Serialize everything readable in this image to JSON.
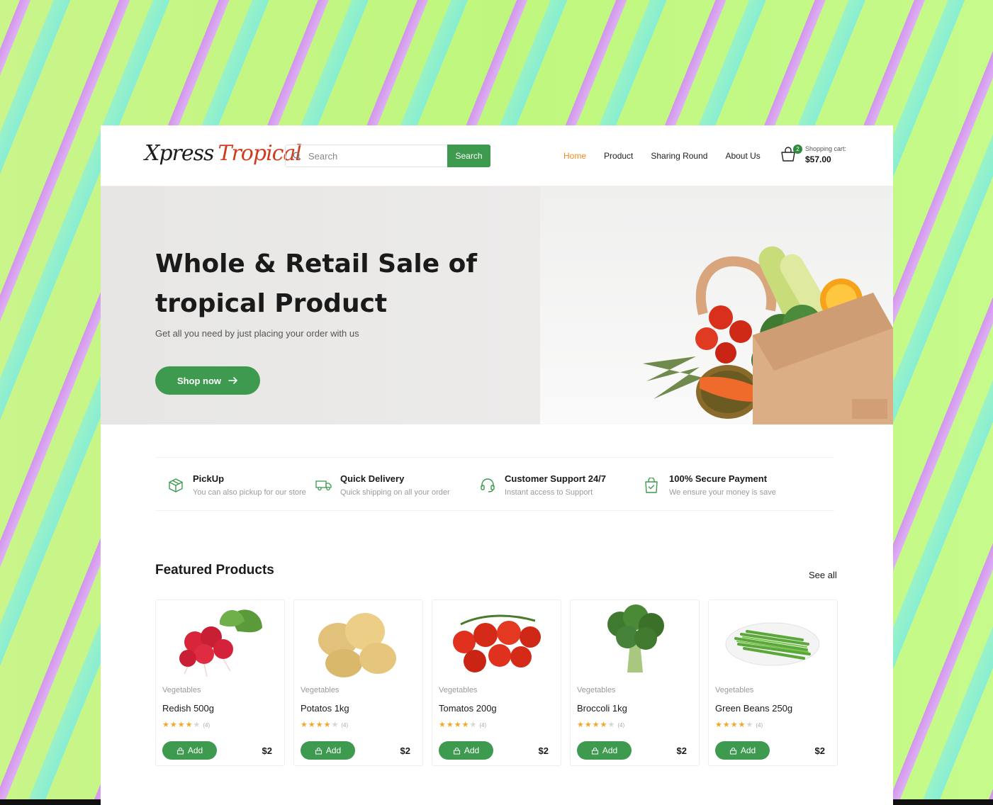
{
  "header": {
    "logo_part1": "Xpress",
    "logo_part2": "Tropical",
    "search_placeholder": "Search",
    "search_button": "Search",
    "nav": [
      "Home",
      "Product",
      "Sharing Round",
      "About Us"
    ],
    "active_nav": "Home",
    "cart_label": "Shopping cart:",
    "cart_amount": "$57.00",
    "cart_count": "2"
  },
  "hero": {
    "title": "Whole & Retail Sale of tropical Product",
    "subtitle": "Get all you need by just placing your order with us",
    "cta": "Shop now"
  },
  "features": [
    {
      "title": "PickUp",
      "desc": "You can also pickup for our store",
      "icon": "box-icon"
    },
    {
      "title": "Quick Delivery",
      "desc": "Quick shipping on all your order",
      "icon": "truck-icon"
    },
    {
      "title": "Customer Support 24/7",
      "desc": "Instant access to Support",
      "icon": "headset-icon"
    },
    {
      "title": "100% Secure Payment",
      "desc": "We ensure your money is save",
      "icon": "shopping-bag-check-icon"
    }
  ],
  "featured": {
    "title": "Featured Products",
    "see_all": "See all",
    "products": [
      {
        "category": "Vegetables",
        "name": "Redish 500g",
        "rating": 4,
        "reviews": "(4)",
        "add": "Add",
        "price": "$2"
      },
      {
        "category": "Vegetables",
        "name": "Potatos 1kg",
        "rating": 4,
        "reviews": "(4)",
        "add": "Add",
        "price": "$2"
      },
      {
        "category": "Vegetables",
        "name": "Tomatos 200g",
        "rating": 4,
        "reviews": "(4)",
        "add": "Add",
        "price": "$2"
      },
      {
        "category": "Vegetables",
        "name": "Broccoli 1kg",
        "rating": 4,
        "reviews": "(4)",
        "add": "Add",
        "price": "$2"
      },
      {
        "category": "Vegetables",
        "name": "Green Beans 250g",
        "rating": 4,
        "reviews": "(4)",
        "add": "Add",
        "price": "$2"
      }
    ]
  },
  "colors": {
    "brand_green": "#3d9a4e",
    "accent_orange": "#f08a1e",
    "logo_red": "#d13b1e"
  }
}
